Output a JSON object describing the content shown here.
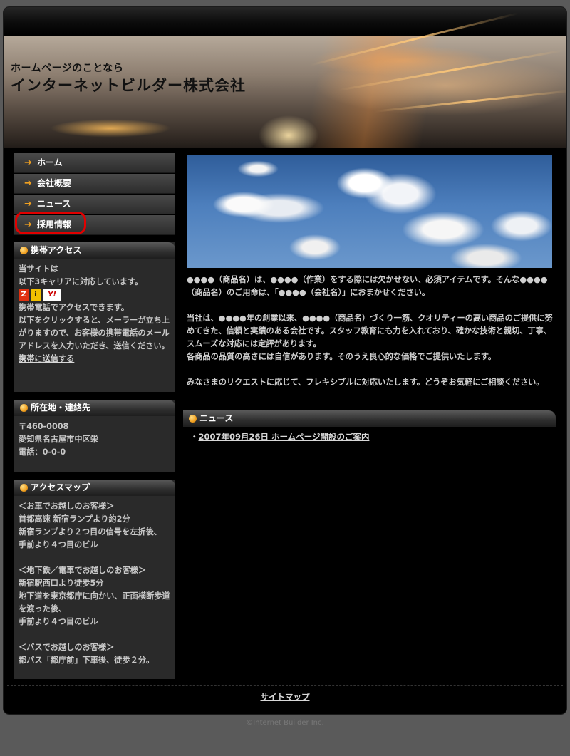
{
  "header": {
    "subtitle": "ホームページのことなら",
    "title": "インターネットビルダー株式会社"
  },
  "nav": {
    "items": [
      {
        "label": "ホーム"
      },
      {
        "label": "会社概要"
      },
      {
        "label": "ニュース"
      },
      {
        "label": "採用情報",
        "highlighted": true
      }
    ],
    "arrow_glyph": "➔",
    "highlight_color": "#e10000"
  },
  "mobile_box": {
    "title": "携帯アクセス",
    "line1": "当サイトは",
    "line2": "以下3キャリアに対応しています。",
    "carriers": [
      {
        "label": "Z",
        "color": "#e03010"
      },
      {
        "label": "i",
        "color": "#f0c000"
      },
      {
        "label": "Y!",
        "color": "#cc0000"
      }
    ],
    "line3": "携帯電話でアクセスできます。",
    "line4": "以下をクリックすると、メーラーが立ち上がりますので、お客様の携帯電話のメールアドレスを入力いただき、送信ください。",
    "link": "携帯に送信する"
  },
  "address_box": {
    "title": "所在地・連絡先",
    "postal": "〒460-0008",
    "address": "愛知県名古屋市中区栄",
    "phone": "電話：0-0-0"
  },
  "map_box": {
    "title": "アクセスマップ",
    "car_head": "＜お車でお越しのお客様＞",
    "car_1": "首都高速 新宿ランプより約2分",
    "car_2": "新宿ランプより２つ目の信号を左折後、",
    "car_3": "手前より４つ目のビル",
    "train_head": "＜地下鉄／電車でお越しのお客様＞",
    "train_1": "新宿駅西口より徒歩5分",
    "train_2": "地下道を東京都庁に向かい、正面横断歩道を渡った後、",
    "train_3": "手前より４つ目のビル",
    "bus_head": "＜バスでお越しのお客様＞",
    "bus_1": "都バス「都庁前」下車後、徒歩２分。"
  },
  "main": {
    "para1": "●●●●（商品名）は、●●●●（作業）をする際には欠かせない、必須アイテムです。そんな●●●●（商品名）のご用命は、「●●●●（会社名）」におまかせください。",
    "para2": "当社は、●●●●年の創業以来、●●●●（商品名）づくり一筋、クオリティーの高い商品のご提供に努めてきた、信頼と実績のある会社です。スタッフ教育にも力を入れており、確かな技術と親切、丁寧、スムーズな対応には定評があります。",
    "para2b": "各商品の品質の高さには自信があります。そのうえ良心的な価格でご提供いたします。",
    "para3": "みなさまのリクエストに応じて、フレキシブルに対応いたします。どうぞお気軽にご相談ください。"
  },
  "news": {
    "title": "ニュース",
    "bullet": "・",
    "items": [
      {
        "text": "2007年09月26日 ホームページ開設のご案内"
      }
    ]
  },
  "footer": {
    "sitemap": "サイトマップ",
    "copyright": "©Internet Builder Inc."
  },
  "colors": {
    "accent_orange": "#f0a020",
    "background": "#000000",
    "panel": "#2a2a2a",
    "page_bg": "#5a5a5a"
  }
}
